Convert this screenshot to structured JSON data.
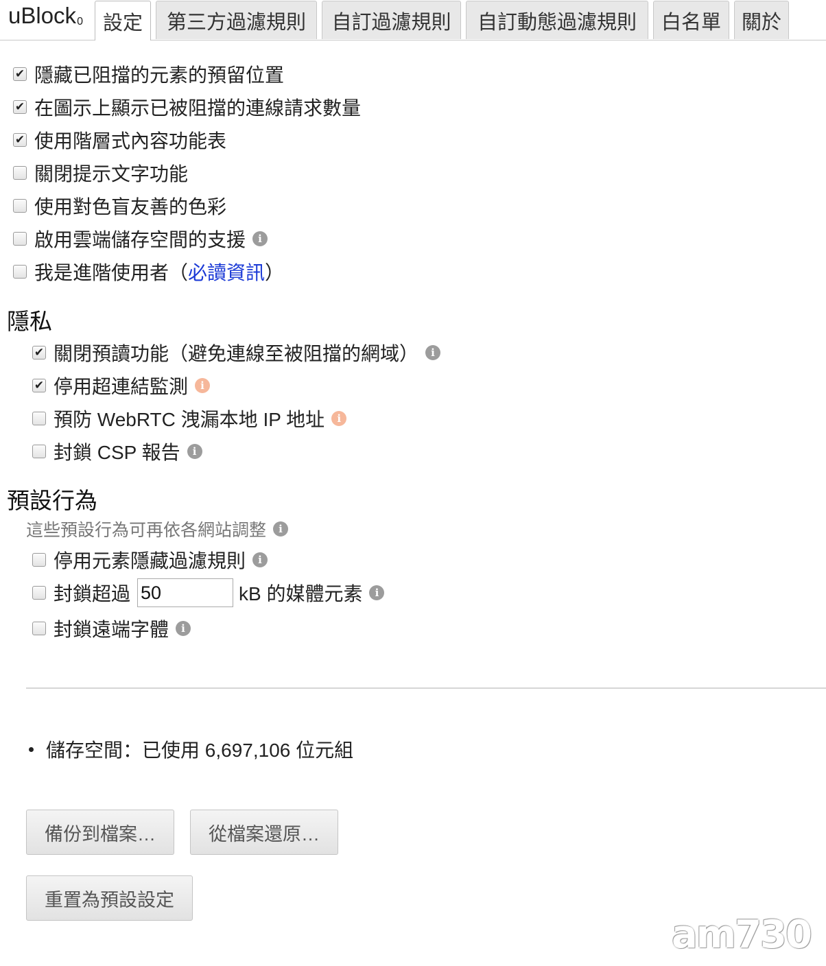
{
  "brand": {
    "name": "uBlock",
    "suffix": "0"
  },
  "tabs": [
    {
      "label": "設定",
      "active": true
    },
    {
      "label": "第三方過濾規則",
      "active": false
    },
    {
      "label": "自訂過濾規則",
      "active": false
    },
    {
      "label": "自訂動態過濾規則",
      "active": false
    },
    {
      "label": "白名單",
      "active": false
    },
    {
      "label": "關於",
      "active": false
    }
  ],
  "general": [
    {
      "label": "隱藏已阻擋的元素的預留位置",
      "checked": true
    },
    {
      "label": "在圖示上顯示已被阻擋的連線請求數量",
      "checked": true
    },
    {
      "label": "使用階層式內容功能表",
      "checked": true
    },
    {
      "label": "關閉提示文字功能",
      "checked": false
    },
    {
      "label": "使用對色盲友善的色彩",
      "checked": false
    },
    {
      "label": "啟用雲端儲存空間的支援",
      "checked": false
    },
    {
      "label": "我是進階使用者（",
      "link": "必讀資訊",
      "suffix": "）",
      "checked": false
    }
  ],
  "privacy": {
    "title": "隱私",
    "items": [
      {
        "label": "關閉預讀功能（避免連線至被阻擋的網域）",
        "checked": true
      },
      {
        "label": "停用超連結監測",
        "checked": true
      },
      {
        "label": "預防 WebRTC 洩漏本地 IP 地址",
        "checked": false
      },
      {
        "label": "封鎖 CSP 報告",
        "checked": false
      }
    ]
  },
  "defaults": {
    "title": "預設行為",
    "note": "這些預設行為可再依各網站調整",
    "items": [
      {
        "label": "停用元素隱藏過濾規則",
        "checked": false
      },
      {
        "label": "封鎖超過",
        "value": "50",
        "suffix": "kB 的媒體元素",
        "checked": false
      },
      {
        "label": "封鎖遠端字體",
        "checked": false
      }
    ]
  },
  "storage": {
    "text": "儲存空間：已使用 6,697,106 位元組"
  },
  "buttons": {
    "backup": "備份到檔案…",
    "restore": "從檔案還原…",
    "reset": "重置為預設設定"
  },
  "icons": {
    "info": "info-icon",
    "check": "✔"
  },
  "colors": {
    "link": "#1a39d6",
    "info": "#9c9c9c",
    "info_warn": "#f6b79a"
  },
  "watermark": "am730"
}
